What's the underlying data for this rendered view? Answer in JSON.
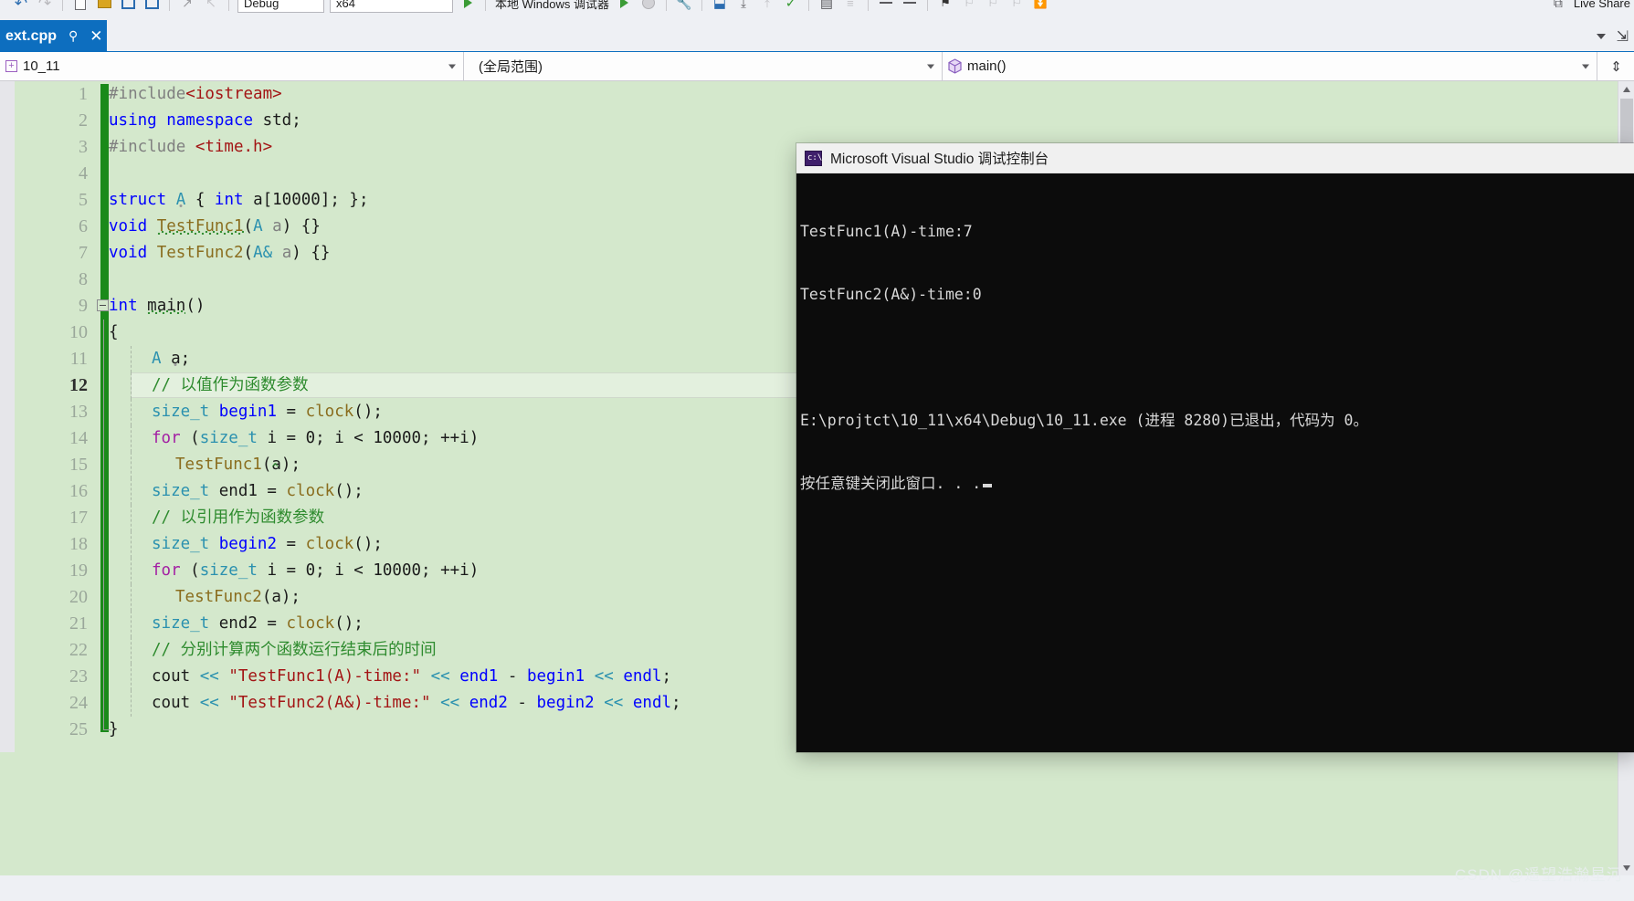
{
  "toolbar": {
    "config_combo": "Debug",
    "platform_combo": "x64",
    "run_label": "本地 Windows 调试器",
    "icons": [
      "undo-icon",
      "redo-icon",
      "page-icon",
      "folder-icon",
      "window-icon",
      "window-split-icon",
      "forward-icon",
      "back-icon",
      "run-icon",
      "stop-icon",
      "wrench-icon",
      "step-icon",
      "check-icon",
      "bookmark-icon",
      "comment-icon",
      "uncomment-icon",
      "live-share-icon"
    ],
    "live_share": "Live Share"
  },
  "tab": {
    "title": "ext.cpp",
    "pin_icon": "pin-icon",
    "close_icon": "close-icon"
  },
  "navbar": {
    "project": "10_11",
    "scope": "(全局范围)",
    "member": "main()",
    "project_icon": "plus-box-icon",
    "member_icon": "method-cube-icon",
    "split_icon": "split-view-icon"
  },
  "editor": {
    "current_line": 12,
    "lines": [
      {
        "n": 1,
        "text": "#include<iostream>"
      },
      {
        "n": 2,
        "text": "using namespace std;"
      },
      {
        "n": 3,
        "text": "#include <time.h>"
      },
      {
        "n": 4,
        "text": ""
      },
      {
        "n": 5,
        "text": "struct A { int a[10000]; };"
      },
      {
        "n": 6,
        "text": "void TestFunc1(A a) {}"
      },
      {
        "n": 7,
        "text": "void TestFunc2(A& a) {}"
      },
      {
        "n": 8,
        "text": ""
      },
      {
        "n": 9,
        "text": "int main()"
      },
      {
        "n": 10,
        "text": "{"
      },
      {
        "n": 11,
        "text": "    A a;"
      },
      {
        "n": 12,
        "text": "    // 以值作为函数参数"
      },
      {
        "n": 13,
        "text": "    size_t begin1 = clock();"
      },
      {
        "n": 14,
        "text": "    for (size_t i = 0; i < 10000; ++i)"
      },
      {
        "n": 15,
        "text": "        TestFunc1(a);"
      },
      {
        "n": 16,
        "text": "    size_t end1 = clock();"
      },
      {
        "n": 17,
        "text": "    // 以引用作为函数参数"
      },
      {
        "n": 18,
        "text": "    size_t begin2 = clock();"
      },
      {
        "n": 19,
        "text": "    for (size_t i = 0; i < 10000; ++i)"
      },
      {
        "n": 20,
        "text": "        TestFunc2(a);"
      },
      {
        "n": 21,
        "text": "    size_t end2 = clock();"
      },
      {
        "n": 22,
        "text": "    // 分别计算两个函数运行结束后的时间"
      },
      {
        "n": 23,
        "text": "    cout << \"TestFunc1(A)-time:\" << end1 - begin1 << endl;"
      },
      {
        "n": 24,
        "text": "    cout << \"TestFunc2(A&)-time:\" << end2 - begin2 << endl;"
      },
      {
        "n": 25,
        "text": "}"
      }
    ]
  },
  "console": {
    "title": "Microsoft Visual Studio 调试控制台",
    "icon": "console-app-icon",
    "output": [
      "TestFunc1(A)-time:7",
      "TestFunc2(A&)-time:0",
      "",
      "E:\\projtct\\10_11\\x64\\Debug\\10_11.exe (进程 8280)已退出，代码为 0。",
      "按任意键关闭此窗口. . ."
    ]
  },
  "watermark": "CSDN @遥望浩瀚星河",
  "colors": {
    "tab_active": "#0d6ebf",
    "editor_bg": "#d4e8cc",
    "change_bar": "#1a8a1a",
    "console_bg": "#0c0c0c",
    "keyword": "#0000ff",
    "type": "#2b91af",
    "string": "#a31515",
    "comment": "#2e8b2e",
    "preprocessor": "#808080",
    "function": "#8a6d1e",
    "for_keyword": "#a31fa3"
  }
}
